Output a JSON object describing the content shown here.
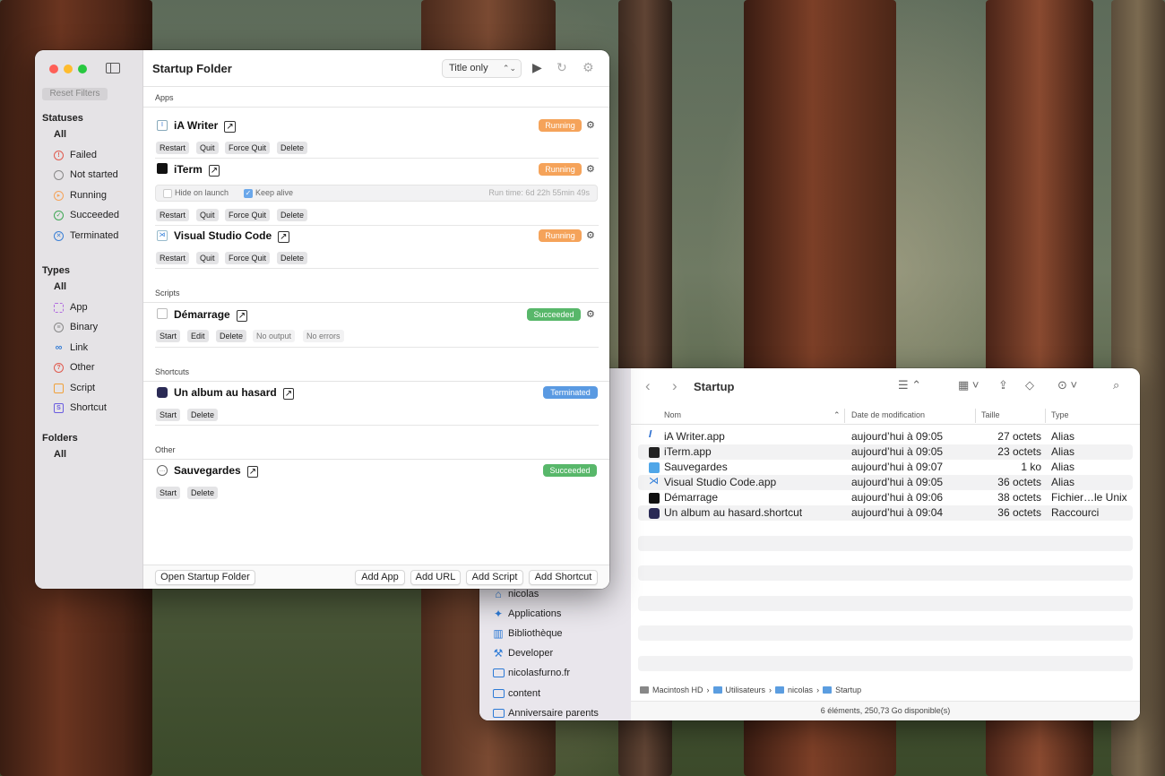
{
  "startup": {
    "title": "Startup Folder",
    "reset_filters": "Reset Filters",
    "view_select": "Title only",
    "sidebar": {
      "statuses_title": "Statuses",
      "statuses_all": "All",
      "statuses": [
        "Failed",
        "Not started",
        "Running",
        "Succeeded",
        "Terminated"
      ],
      "types_title": "Types",
      "types_all": "All",
      "types": [
        "App",
        "Binary",
        "Link",
        "Other",
        "Script",
        "Shortcut"
      ],
      "folders_title": "Folders",
      "folders_all": "All"
    },
    "sections": {
      "apps": "Apps",
      "scripts": "Scripts",
      "shortcuts": "Shortcuts",
      "other": "Other"
    },
    "apps": [
      {
        "name": "iA Writer",
        "status": "Running",
        "actions": [
          "Restart",
          "Quit",
          "Force Quit",
          "Delete"
        ]
      },
      {
        "name": "iTerm",
        "status": "Running",
        "actions": [
          "Restart",
          "Quit",
          "Force Quit",
          "Delete"
        ],
        "hide_on_launch": "Hide on launch",
        "keep_alive": "Keep alive",
        "runtime": "Run time: 6d 22h 55min 49s"
      },
      {
        "name": "Visual Studio Code",
        "status": "Running",
        "actions": [
          "Restart",
          "Quit",
          "Force Quit",
          "Delete"
        ]
      }
    ],
    "scripts": [
      {
        "name": "Démarrage",
        "status": "Succeeded",
        "actions": [
          "Start",
          "Edit",
          "Delete"
        ],
        "output": "No output",
        "errors": "No errors"
      }
    ],
    "shortcuts": [
      {
        "name": "Un album au hasard",
        "status": "Terminated",
        "actions": [
          "Start",
          "Delete"
        ]
      }
    ],
    "other": [
      {
        "name": "Sauvegardes",
        "status": "Succeeded",
        "actions": [
          "Start",
          "Delete"
        ]
      }
    ],
    "bottom": {
      "open_folder": "Open Startup Folder",
      "add_app": "Add App",
      "add_url": "Add URL",
      "add_script": "Add Script",
      "add_shortcut": "Add Shortcut"
    }
  },
  "finder": {
    "title": "Startup",
    "columns": [
      "Nom",
      "Date de modification",
      "Taille",
      "Type"
    ],
    "files": [
      {
        "name": "iA Writer.app",
        "date": "aujourd’hui à 09:05",
        "size": "27 octets",
        "type": "Alias"
      },
      {
        "name": "iTerm.app",
        "date": "aujourd’hui à 09:05",
        "size": "23 octets",
        "type": "Alias"
      },
      {
        "name": "Sauvegardes",
        "date": "aujourd’hui à 09:07",
        "size": "1 ko",
        "type": "Alias"
      },
      {
        "name": "Visual Studio Code.app",
        "date": "aujourd’hui à 09:05",
        "size": "36 octets",
        "type": "Alias"
      },
      {
        "name": "Démarrage",
        "date": "aujourd’hui à 09:06",
        "size": "38 octets",
        "type": "Fichier…le Unix"
      },
      {
        "name": "Un album au hasard.shortcut",
        "date": "aujourd’hui à 09:04",
        "size": "36 octets",
        "type": "Raccourci"
      }
    ],
    "sidebar": [
      "nicolas",
      "Applications",
      "Bibliothèque",
      "Developer",
      "nicolasfurno.fr",
      "content",
      "Anniversaire parents"
    ],
    "path": [
      "Macintosh HD",
      "Utilisateurs",
      "nicolas",
      "Startup"
    ],
    "status": "6 éléments, 250,73 Go disponible(s)"
  },
  "colors": {
    "running": "#f5a35a",
    "succeeded": "#58b76a",
    "terminated": "#5a9ae2"
  }
}
